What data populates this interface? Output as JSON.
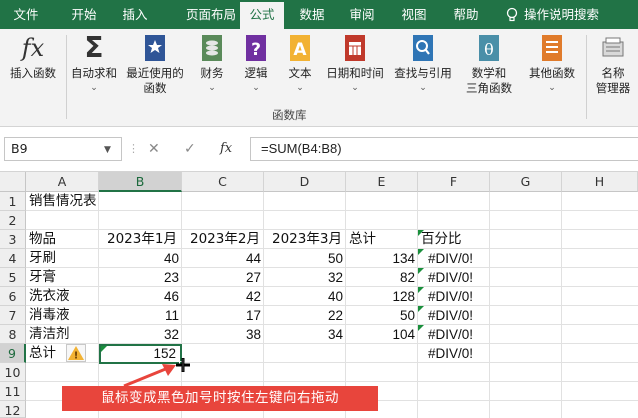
{
  "tabs": [
    "文件",
    "开始",
    "插入",
    "页面布局",
    "公式",
    "数据",
    "审阅",
    "视图",
    "帮助",
    "操作说明搜索"
  ],
  "active_tab": "公式",
  "ribbon": {
    "insert_function": "插入函数",
    "autosum": "自动求和",
    "recent_1": "最近使用的",
    "recent_2": "函数",
    "financial": "财务",
    "logical": "逻辑",
    "text": "文本",
    "datetime": "日期和时间",
    "lookup": "查找与引用",
    "math_1": "数学和",
    "math_2": "三角函数",
    "other": "其他函数",
    "name_mgr_1": "名称",
    "name_mgr_2": "管理器",
    "group_label": "函数库"
  },
  "formula_bar": {
    "name_box": "B9",
    "cancel": "✕",
    "enter": "✓",
    "fx": "fx",
    "formula": "=SUM(B4:B8)"
  },
  "columns": [
    "A",
    "B",
    "C",
    "D",
    "E",
    "F",
    "G",
    "H"
  ],
  "rows": [
    "1",
    "2",
    "3",
    "4",
    "5",
    "6",
    "7",
    "8",
    "9",
    "10",
    "11",
    "12"
  ],
  "sheet": {
    "title": "销售情况表",
    "headers": [
      "物品",
      "2023年1月",
      "2023年2月",
      "2023年3月",
      "总计",
      "百分比"
    ],
    "data": [
      [
        "牙刷",
        "40",
        "44",
        "50",
        "134",
        "#DIV/0!"
      ],
      [
        "牙膏",
        "23",
        "27",
        "32",
        "82",
        "#DIV/0!"
      ],
      [
        "洗衣液",
        "46",
        "42",
        "40",
        "128",
        "#DIV/0!"
      ],
      [
        "消毒液",
        "11",
        "17",
        "22",
        "50",
        "#DIV/0!"
      ],
      [
        "清洁剂",
        "32",
        "38",
        "34",
        "104",
        "#DIV/0!"
      ]
    ],
    "total_label": "总计",
    "total_b": "152",
    "total_f": "#DIV/0!",
    "warn_symbol": "!"
  },
  "annotation": "鼠标变成黑色加号时按住左键向右拖动",
  "colors": {
    "excel_green": "#217346",
    "annotation_red": "#e8453c"
  }
}
